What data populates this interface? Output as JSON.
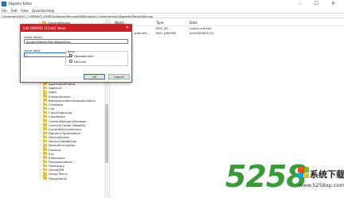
{
  "window": {
    "title": "Registry Editor",
    "minimize_glyph": "–",
    "maximize_glyph": "☐",
    "close_glyph": "✕"
  },
  "menu": [
    "File",
    "Edit",
    "View",
    "Favorites",
    "Help"
  ],
  "address": "Computer\\HKEY_CURRENT_USER\\Software\\Microsoft\\Windows\\CurrentVersion\\Applets\\Paint\\Settings",
  "tree": {
    "top_item": "CurrentVersion",
    "items": [
      "ApplicationFrame",
      "AppHost",
      "AppX",
      "Authentication",
      "BackgroundAccessApplications",
      "ClickNote",
      "Clip",
      "CloudCapturing",
      "CloudStore",
      "ContentDeliveryManager",
      "Controls Folder (Wow64)",
      "CurrentFileCollections",
      "DeliveryOptimization",
      "DeviceAccess",
      "DeviceCapabilities",
      "DeviceEncryption",
      "Explorer",
      "Ext",
      "Extensions",
      "FileAssociations",
      "FileHistory",
      "GameDVR",
      "Group Policy",
      "Holographic"
    ]
  },
  "values_pane": {
    "columns": {
      "name": "Name",
      "type": "Type",
      "data": "Data"
    },
    "rows": [
      {
        "name": "",
        "type": "REG_SZ",
        "data": "(value not set)"
      },
      {
        "name": "odernPa...",
        "type": "REG_DWORD",
        "data": "0x00000000 (0)"
      }
    ]
  },
  "dialog": {
    "title": "Edit DWORD (32-bit) Value",
    "close_glyph": "✕",
    "value_name_label": "Value name:",
    "value_name": "DisableModernPaintBootstrap",
    "value_data_label": "Value data:",
    "value_data": "1",
    "base_label": "Base",
    "base_options": [
      "Hexadecimal",
      "Decimal"
    ],
    "base_selected": "Hexadecimal",
    "ok_label": "OK",
    "cancel_label": "Cancel"
  },
  "watermark": {
    "number": "5258",
    "site_name": "系统下载",
    "url": "www.5258xp.com",
    "colors": {
      "number": "#3a9a3a",
      "logo": [
        "#f25022",
        "#7fba00",
        "#00a4ef",
        "#ffb900"
      ]
    }
  },
  "colors": {
    "dialog_titlebar": "#c81e24",
    "folder": "#e5c247",
    "focus_border": "#2a6fd6"
  }
}
